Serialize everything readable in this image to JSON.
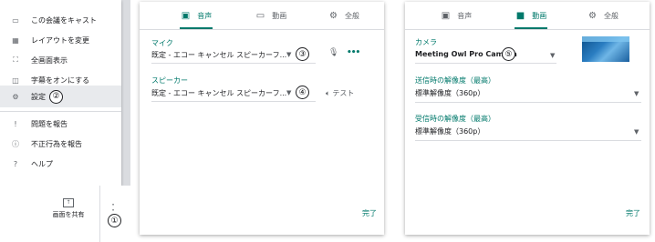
{
  "menu": {
    "items": [
      {
        "label": "この会議をキャスト",
        "icon": "cast-icon"
      },
      {
        "label": "レイアウトを変更",
        "icon": "layout-icon"
      },
      {
        "label": "全画面表示",
        "icon": "fullscreen-icon"
      },
      {
        "label": "字幕をオンにする",
        "icon": "captions-icon"
      },
      {
        "label": "設定",
        "icon": "gear-icon"
      },
      {
        "label": "問題を報告",
        "icon": "feedback-icon"
      },
      {
        "label": "不正行為を報告",
        "icon": "warning-icon"
      },
      {
        "label": "ヘルプ",
        "icon": "help-icon"
      }
    ],
    "share_label": "画面を共有"
  },
  "annotations": {
    "one": "①",
    "two": "②",
    "three": "③",
    "four": "④",
    "five": "⑤"
  },
  "tabs": {
    "audio": "音声",
    "video": "動画",
    "general": "全般"
  },
  "audio": {
    "mic_label": "マイク",
    "mic_value": "既定 - エコー キャンセル スピーカーフ...",
    "speaker_label": "スピーカー",
    "speaker_value": "既定 - エコー キャンセル スピーカーフ...",
    "test_label": "テスト",
    "done": "完了"
  },
  "video": {
    "camera_label": "カメラ",
    "camera_value": "Meeting Owl Pro Camera",
    "send_label": "送信時の解像度（最高）",
    "send_value": "標準解像度（360p）",
    "recv_label": "受信時の解像度（最高）",
    "recv_value": "標準解像度（360p）",
    "done": "完了"
  },
  "colors": {
    "accent": "#00796b",
    "divider": "#dadce0"
  }
}
